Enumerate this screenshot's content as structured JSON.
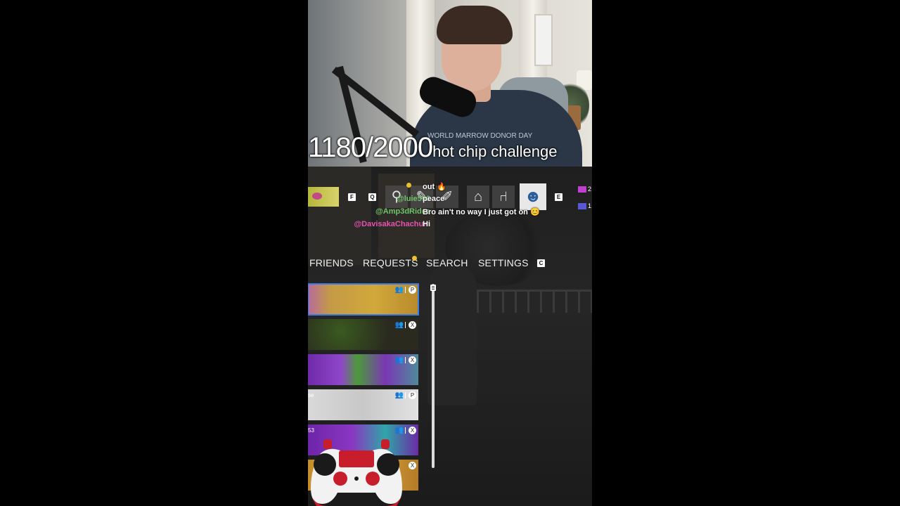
{
  "overlay": {
    "counter": "1180/2000",
    "challenge": "hot chip challenge",
    "shirt_text": "WORLD MARROW DONOR DAY"
  },
  "toolbar": {
    "key_left_1": "F",
    "key_left_2": "Q",
    "key_right": "E",
    "tools": [
      {
        "icon": "magnifier-icon",
        "glyph": "⚲"
      },
      {
        "icon": "stamp-icon",
        "glyph": "✎"
      },
      {
        "icon": "brush-icon",
        "glyph": "✐"
      },
      {
        "icon": "house-icon",
        "glyph": "⌂"
      },
      {
        "icon": "chair-icon",
        "glyph": "⑁"
      },
      {
        "icon": "people-icon",
        "glyph": "☻"
      }
    ],
    "stat_1": "2",
    "stat_2": "1"
  },
  "chat": {
    "messages": [
      {
        "user": "",
        "text": "out 🔥"
      },
      {
        "user": "@luie550",
        "text": "peace"
      },
      {
        "user": "@Amp3dRides",
        "text": "Bro ain't no way I just got on 😊"
      },
      {
        "user": "@DavisakaChachum",
        "text": "Hi"
      }
    ]
  },
  "nav": {
    "friends": "FRIENDS",
    "requests": "REQUESTS",
    "search": "SEARCH",
    "settings": "SETTINGS",
    "key_hint": "C"
  },
  "list": {
    "cards": [
      {
        "platform": "playstation",
        "glyph": "P",
        "side": ""
      },
      {
        "platform": "xbox",
        "glyph": "X",
        "side": ""
      },
      {
        "platform": "xbox",
        "glyph": "X",
        "side": ""
      },
      {
        "platform": "playstation",
        "glyph": "P",
        "side": "se"
      },
      {
        "platform": "xbox",
        "glyph": "X",
        "side": "53"
      },
      {
        "platform": "xbox",
        "glyph": "X",
        "side": ""
      }
    ]
  },
  "colors": {
    "selected_outline": "#3c7be0",
    "username_green": "#6fc36b",
    "username_pink": "#e453ad",
    "notify_dot": "#f2c12e",
    "controller_red": "#c81e2b"
  }
}
